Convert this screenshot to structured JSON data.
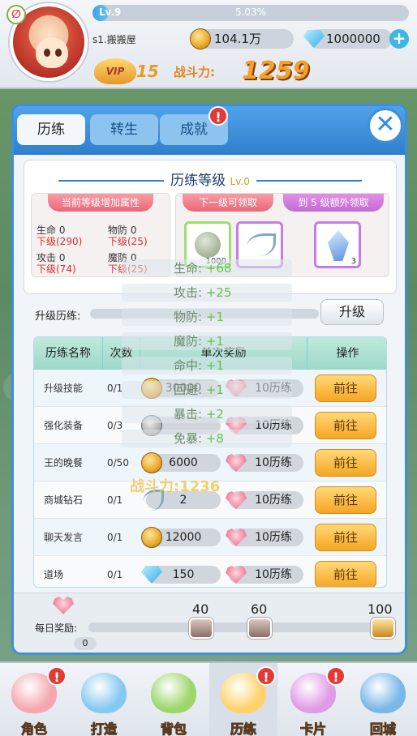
{
  "header": {
    "level": "Lv.9",
    "exp_percent": "5.03%",
    "exp_fraction": 0.0503,
    "server_name": "s1.搬搬屋",
    "gold": "104.1万",
    "diamond": "1000000",
    "vip_level": "15",
    "vip_text": "VIP",
    "power_label": "战斗力:",
    "power_value": "1259"
  },
  "tabs": [
    {
      "label": "历练",
      "active": true
    },
    {
      "label": "转生",
      "active": false
    },
    {
      "label": "成就",
      "active": false,
      "badge": "!"
    }
  ],
  "training": {
    "title": "历练等级",
    "level": "Lv.0",
    "current_attr_title": "当前等级增加属性",
    "next_reward_title": "下一级可领取",
    "extra_reward_title": "到 5 级额外领取",
    "attrs": [
      {
        "name": "生命",
        "value": "0",
        "next": "下级(290)"
      },
      {
        "name": "物防",
        "value": "0",
        "next": "下级(25)"
      },
      {
        "name": "攻击",
        "value": "0",
        "next": "下级(74)"
      },
      {
        "name": "魔防",
        "value": "0",
        "next": "下级(25)"
      }
    ],
    "next_items": [
      {
        "icon": "coin-item-icon",
        "count": "1000"
      },
      {
        "icon": "feather-icon",
        "count": ""
      }
    ],
    "extra_items": [
      {
        "icon": "crystal-icon",
        "count": "3"
      }
    ],
    "upgrade_label": "升级历练:",
    "upgrade_progress": 0,
    "upgrade_button": "升级"
  },
  "table": {
    "headers": [
      "历练名称",
      "次数",
      "单次奖励",
      "操作"
    ],
    "rows": [
      {
        "name": "升级技能",
        "count": "0/1",
        "reward_icon": "coin-icon",
        "reward": "30000",
        "exp": "10历练",
        "action": "前往"
      },
      {
        "name": "强化装备",
        "count": "0/3",
        "reward_icon": "silver-coin-icon",
        "reward": "",
        "exp": "10历练",
        "action": "前往"
      },
      {
        "name": "王的晚餐",
        "count": "0/50",
        "reward_icon": "coin-icon",
        "reward": "6000",
        "exp": "10历练",
        "action": "前往"
      },
      {
        "name": "商城钻石",
        "count": "0/1",
        "reward_icon": "feather-icon",
        "reward": "2",
        "exp": "10历练",
        "action": "前往"
      },
      {
        "name": "聊天发言",
        "count": "0/1",
        "reward_icon": "coin-icon",
        "reward": "12000",
        "exp": "10历练",
        "action": "前往"
      },
      {
        "name": "道场",
        "count": "0/1",
        "reward_icon": "gem-icon",
        "reward": "150",
        "exp": "10历练",
        "action": "前往"
      }
    ]
  },
  "daily": {
    "label": "每日奖励:",
    "count": "0",
    "progress": 0,
    "milestones": [
      "40",
      "60",
      "100"
    ]
  },
  "float_tip": {
    "rows": [
      {
        "name": "生命:",
        "value": "+68"
      },
      {
        "name": "攻击:",
        "value": "+25"
      },
      {
        "name": "物防:",
        "value": "+1"
      },
      {
        "name": "魔防:",
        "value": "+1"
      },
      {
        "name": "命中:",
        "value": "+1"
      },
      {
        "name": "回避:",
        "value": "+1"
      },
      {
        "name": "暴击:",
        "value": "+2"
      },
      {
        "name": "免暴:",
        "value": "+8"
      }
    ],
    "power": "战斗力:1236"
  },
  "bottom_nav": [
    {
      "label": "角色",
      "icon": "cowboy-hat-icon",
      "badge": "!",
      "color": "#f4a7b0"
    },
    {
      "label": "打造",
      "icon": "hammer-icon",
      "badge": "",
      "color": "#86c9f0"
    },
    {
      "label": "背包",
      "icon": "backpack-icon",
      "badge": "",
      "color": "#9ed66b"
    },
    {
      "label": "历练",
      "icon": "scroll-icon",
      "badge": "!",
      "color": "#ffd36b",
      "active": true
    },
    {
      "label": "卡片",
      "icon": "card-icon",
      "badge": "!",
      "color": "#e09be6"
    },
    {
      "label": "回城",
      "icon": "castle-icon",
      "badge": "",
      "color": "#7ab8e8"
    }
  ]
}
